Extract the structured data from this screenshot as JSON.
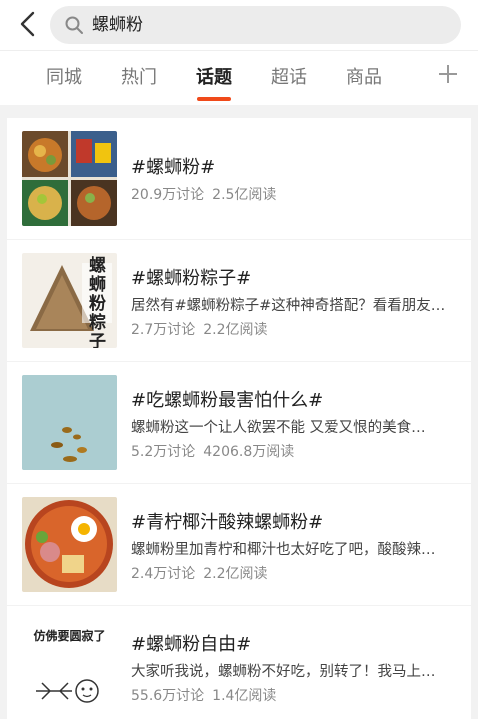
{
  "search": {
    "query": "螺蛳粉"
  },
  "tabs": [
    {
      "label": "同城"
    },
    {
      "label": "热门"
    },
    {
      "label": "话题"
    },
    {
      "label": "超话"
    },
    {
      "label": "商品"
    }
  ],
  "active_tab": "话题",
  "accent_color": "#f04a1a",
  "icons": {
    "back": "back-chevron-icon",
    "search": "search-icon",
    "add": "plus-icon"
  },
  "topics": [
    {
      "title": "#螺蛳粉#",
      "description": "",
      "discussions": "20.9万讨论",
      "reads": "2.5亿阅读",
      "thumb_label": ""
    },
    {
      "title": "#螺蛳粉粽子#",
      "description": "居然有#螺蛳粉粽子#这种神奇搭配？看看朋友…",
      "discussions": "2.7万讨论",
      "reads": "2.2亿阅读",
      "thumb_label": "螺蛳粉粽子"
    },
    {
      "title": "#吃螺蛳粉最害怕什么#",
      "description": "螺蛳粉这一个让人欲罢不能 又爱又恨的美食…",
      "discussions": "5.2万讨论",
      "reads": "4206.8万阅读",
      "thumb_label": ""
    },
    {
      "title": "#青柠椰汁酸辣螺蛳粉#",
      "description": "螺蛳粉里加青柠和椰汁也太好吃了吧，酸酸辣…",
      "discussions": "2.4万讨论",
      "reads": "2.2亿阅读",
      "thumb_label": ""
    },
    {
      "title": "#螺蛳粉自由#",
      "description": "大家听我说，螺蛳粉不好吃，别转了！我马上…",
      "discussions": "55.6万讨论",
      "reads": "1.4亿阅读",
      "thumb_label": "仿佛要圆寂了"
    }
  ]
}
